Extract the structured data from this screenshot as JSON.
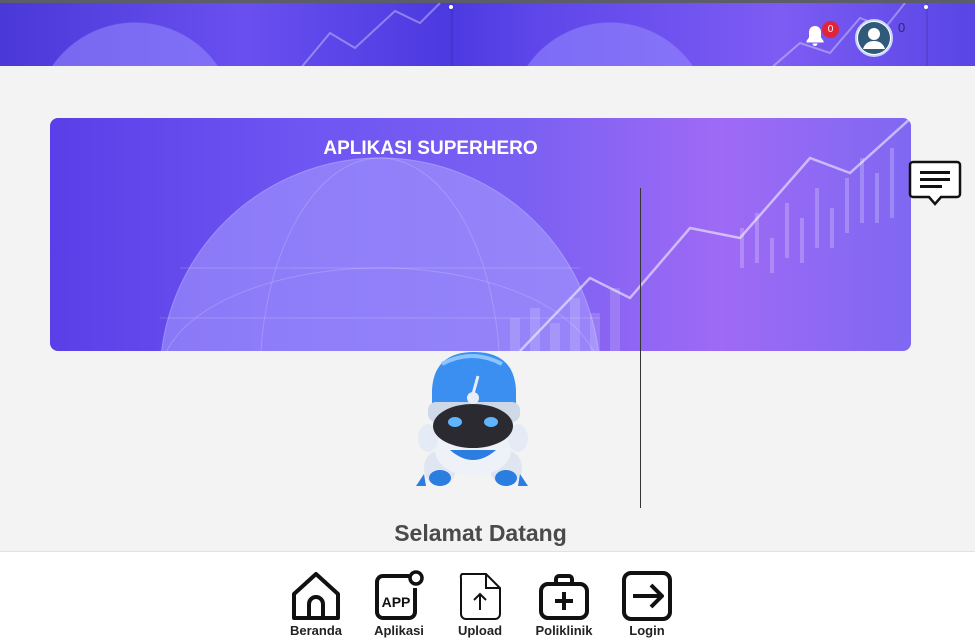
{
  "header": {
    "notification_count": "0",
    "user_count": "0",
    "icons": {
      "notification": "bell-icon",
      "user": "user-avatar-icon"
    }
  },
  "banner": {
    "title": "APLIKASI SUPERHERO"
  },
  "chat": {
    "icon": "message-icon"
  },
  "welcome": {
    "text": "Selamat Datang"
  },
  "bottom_nav": {
    "items": [
      {
        "label": "Beranda",
        "icon": "home-icon"
      },
      {
        "label": "Aplikasi",
        "icon": "app-icon"
      },
      {
        "label": "Upload",
        "icon": "upload-icon"
      },
      {
        "label": "Poliklinik",
        "icon": "medical-kit-icon"
      },
      {
        "label": "Login",
        "icon": "login-icon"
      }
    ]
  },
  "colors": {
    "brand_purple": "#5b45e8",
    "badge_red": "#e0243c",
    "text_dark": "#222222",
    "background": "#f3f3f3"
  }
}
